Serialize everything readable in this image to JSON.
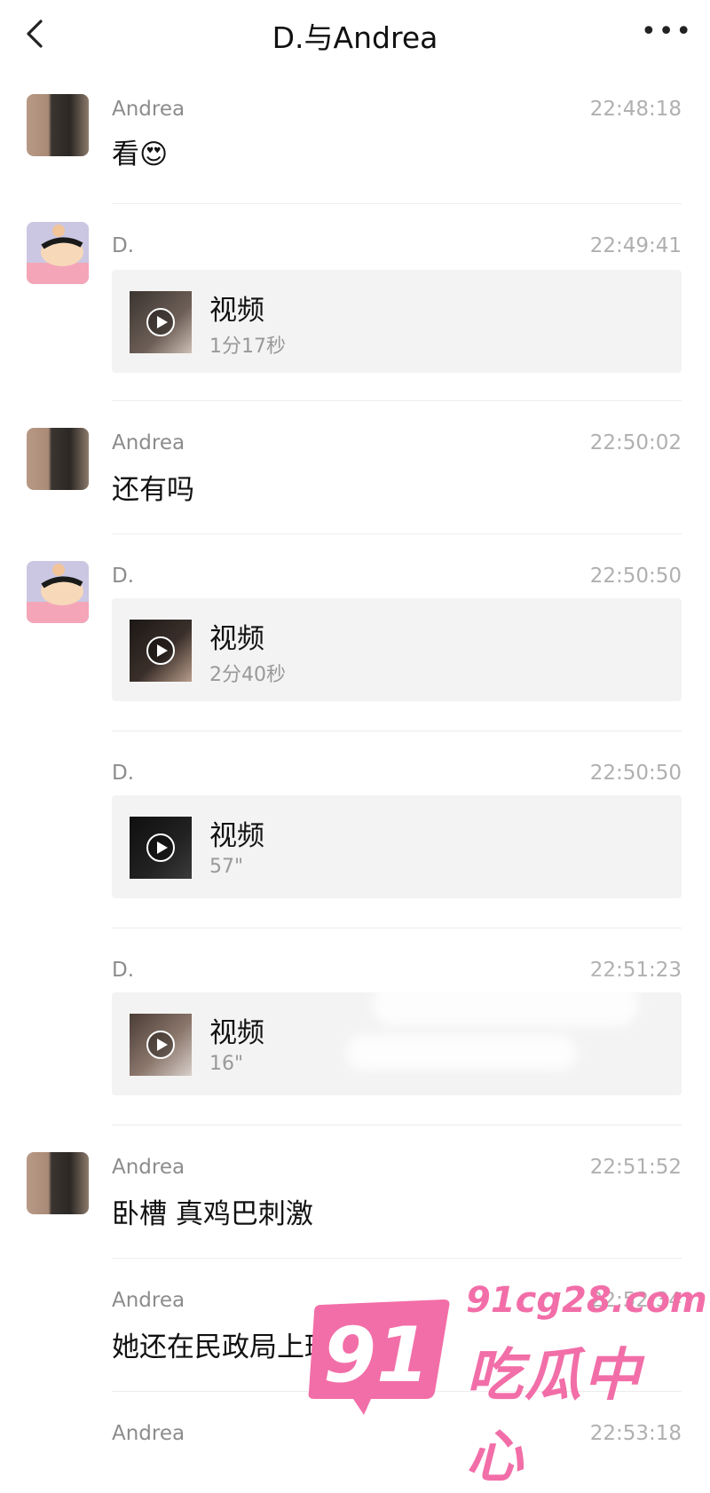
{
  "header": {
    "title": "D.与Andrea",
    "back_icon": "chevron-left-icon",
    "more_label": "•••"
  },
  "messages": [
    {
      "sender": "Andrea",
      "time": "22:48:18",
      "text": "看😍"
    },
    {
      "sender": "D.",
      "time": "22:49:41",
      "video": {
        "label": "视频",
        "duration": "1分17秒"
      }
    },
    {
      "sender": "Andrea",
      "time": "22:50:02",
      "text": "还有吗"
    },
    {
      "sender": "D.",
      "time": "22:50:50",
      "video": {
        "label": "视频",
        "duration": "2分40秒"
      }
    },
    {
      "sender": "D.",
      "time": "22:50:50",
      "video": {
        "label": "视频",
        "duration": "57\""
      }
    },
    {
      "sender": "D.",
      "time": "22:51:23",
      "video": {
        "label": "视频",
        "duration": "16\""
      }
    },
    {
      "sender": "Andrea",
      "time": "22:51:52",
      "text": "卧槽 真鸡巴刺激"
    },
    {
      "sender": "Andrea",
      "time": "22:52:34",
      "text": "她还在民政局上班吗"
    },
    {
      "sender": "Andrea",
      "time": "22:53:18",
      "text": ""
    }
  ],
  "watermark": {
    "number": "91",
    "url": "91cg28.com",
    "name": "吃瓜中心",
    "color": "#f26ea8"
  }
}
